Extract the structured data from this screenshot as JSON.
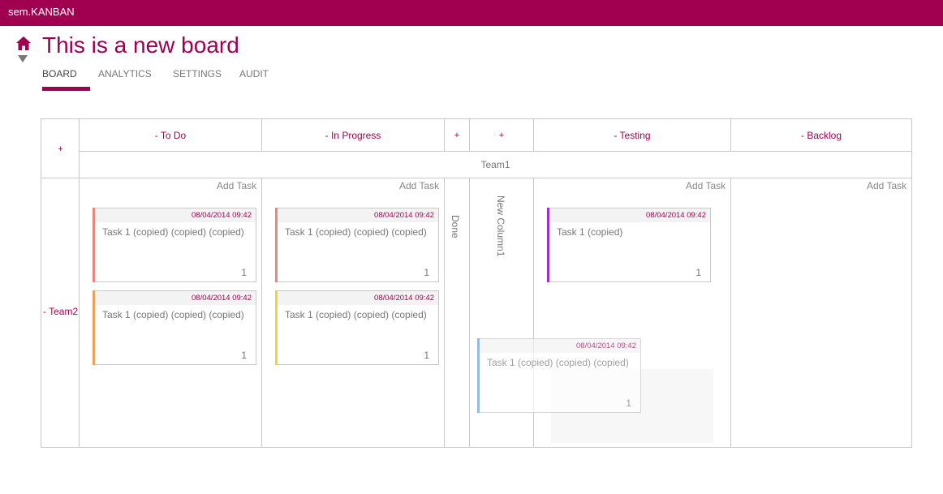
{
  "app": {
    "title": "sem.KANBAN"
  },
  "board": {
    "title": "This is a new board"
  },
  "tabs": [
    {
      "label": "BOARD",
      "active": true
    },
    {
      "label": "ANALYTICS",
      "active": false
    },
    {
      "label": "SETTINGS",
      "active": false
    },
    {
      "label": "AUDIT",
      "active": false
    }
  ],
  "icons": {
    "home": "home-icon",
    "caret": "caret-down-icon"
  },
  "colors": {
    "brand": "#a10050",
    "stripe_salmon": "#e8867f",
    "stripe_orange": "#eba05c",
    "stripe_yellow": "#e6d642",
    "stripe_purple": "#a22fc7",
    "stripe_blue": "#6a9fd6"
  },
  "grid": {
    "corner_plus": "+",
    "columns": {
      "todo": "- To Do",
      "in_progress": "- In Progress",
      "done_plus": "+",
      "new_col_plus": "+",
      "testing": "- Testing",
      "backlog": "- Backlog"
    },
    "column_lane": "Team1",
    "row_lane": "- Team2",
    "collapsed": {
      "done": "Done",
      "new_column": "New Column1"
    },
    "add_task": "Add Task"
  },
  "cards": [
    {
      "date": "08/04/2014 09:42",
      "title": "Task 1 (copied) (copied) (copied)",
      "count": "1"
    },
    {
      "date": "08/04/2014 09:42",
      "title": "Task 1 (copied) (copied) (copied)",
      "count": "1"
    },
    {
      "date": "08/04/2014 09:42",
      "title": "Task 1 (copied) (copied) (copied)",
      "count": "1"
    },
    {
      "date": "08/04/2014 09:42",
      "title": "Task 1 (copied) (copied) (copied)",
      "count": "1"
    },
    {
      "date": "08/04/2014 09:42",
      "title": "Task 1 (copied)",
      "count": "1"
    },
    {
      "date": "08/04/2014 09:42",
      "title": "Task 1 (copied) (copied) (copied)",
      "count": "1"
    }
  ]
}
